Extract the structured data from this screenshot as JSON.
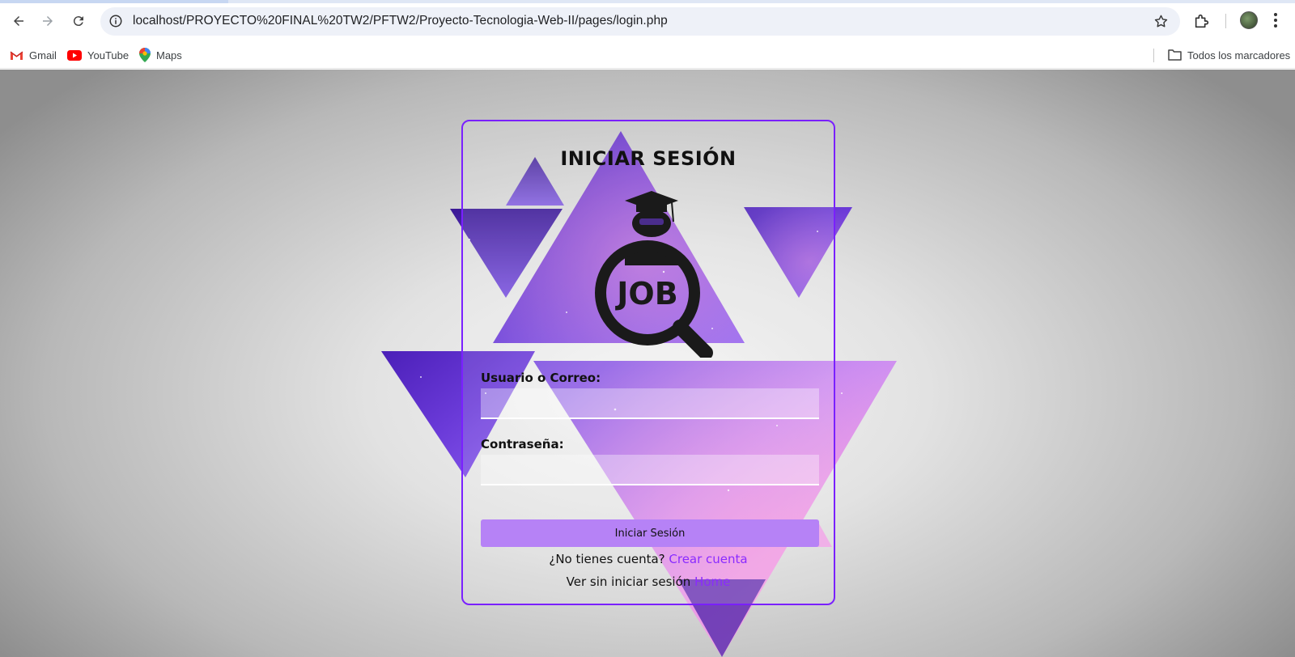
{
  "browser": {
    "url": "localhost/PROYECTO%20FINAL%20TW2/PFTW2/Proyecto-Tecnologia-Web-II/pages/login.php",
    "bookmarks": [
      {
        "label": "Gmail",
        "icon": "gmail-icon"
      },
      {
        "label": "YouTube",
        "icon": "youtube-icon"
      },
      {
        "label": "Maps",
        "icon": "maps-icon"
      }
    ],
    "all_bookmarks_label": "Todos los marcadores"
  },
  "login": {
    "title": "INICIAR SESIÓN",
    "logo_icon": "job-search-graduate-icon",
    "logo_text": "JOB",
    "username_label": "Usuario o Correo:",
    "username_value": "",
    "password_label": "Contraseña:",
    "password_value": "",
    "submit_label": "Iniciar Sesión",
    "no_account_text": "¿No tienes cuenta?",
    "create_account_link": "Crear cuenta",
    "guest_text": "Ver sin iniciar sesión",
    "home_link": "Home"
  },
  "colors": {
    "accent": "#7a20ff",
    "button": "#b682f6",
    "link": "#8a2bff"
  }
}
